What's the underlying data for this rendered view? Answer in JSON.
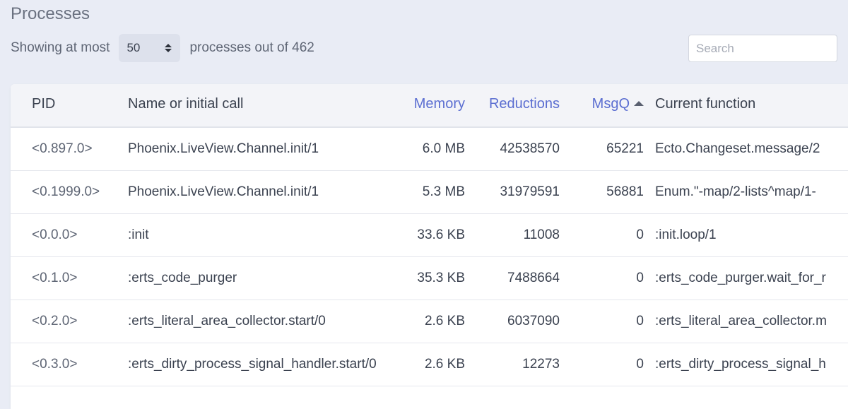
{
  "page_title": "Processes",
  "controls": {
    "prefix": "Showing at most",
    "limit_value": "50",
    "suffix": "processes out of 462",
    "search_placeholder": "Search"
  },
  "table": {
    "headers": {
      "pid": "PID",
      "name": "Name or initial call",
      "memory": "Memory",
      "reductions": "Reductions",
      "msgq": "MsgQ",
      "current_function": "Current function"
    },
    "sort": {
      "column": "MsgQ",
      "direction": "asc"
    },
    "rows": [
      {
        "pid": "<0.897.0>",
        "name": "Phoenix.LiveView.Channel.init/1",
        "memory": "6.0 MB",
        "reductions": "42538570",
        "msgq": "65221",
        "current_function": "Ecto.Changeset.message/2"
      },
      {
        "pid": "<0.1999.0>",
        "name": "Phoenix.LiveView.Channel.init/1",
        "memory": "5.3 MB",
        "reductions": "31979591",
        "msgq": "56881",
        "current_function": "Enum.\"-map/2-lists^map/1-"
      },
      {
        "pid": "<0.0.0>",
        "name": ":init",
        "memory": "33.6 KB",
        "reductions": "11008",
        "msgq": "0",
        "current_function": ":init.loop/1"
      },
      {
        "pid": "<0.1.0>",
        "name": ":erts_code_purger",
        "memory": "35.3 KB",
        "reductions": "7488664",
        "msgq": "0",
        "current_function": ":erts_code_purger.wait_for_r"
      },
      {
        "pid": "<0.2.0>",
        "name": ":erts_literal_area_collector.start/0",
        "memory": "2.6 KB",
        "reductions": "6037090",
        "msgq": "0",
        "current_function": ":erts_literal_area_collector.m"
      },
      {
        "pid": "<0.3.0>",
        "name": ":erts_dirty_process_signal_handler.start/0",
        "memory": "2.6 KB",
        "reductions": "12273",
        "msgq": "0",
        "current_function": ":erts_dirty_process_signal_h"
      }
    ]
  },
  "colors": {
    "background": "#e9ecf5",
    "accent": "#5b6ed1",
    "card": "#ffffff",
    "header_bg": "#f3f4f8"
  }
}
